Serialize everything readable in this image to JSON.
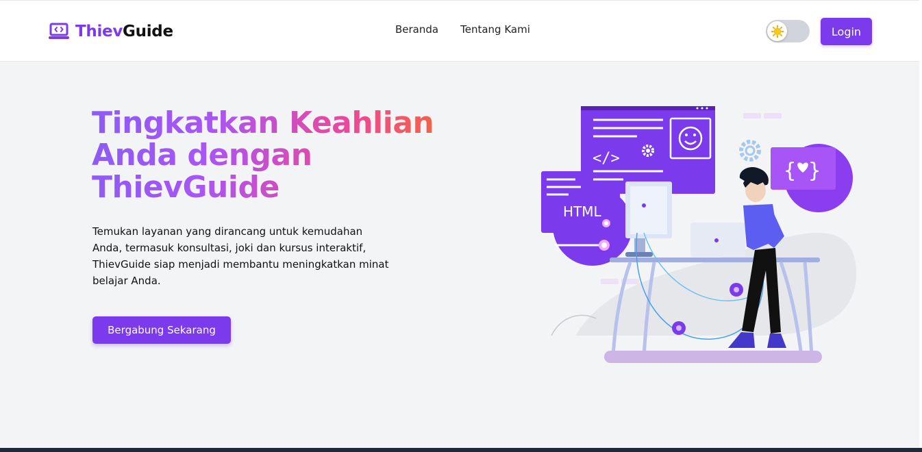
{
  "brand": {
    "part1": "Thiev",
    "part2": "Guide",
    "icon": "laptop-code-icon"
  },
  "nav": {
    "items": [
      {
        "label": "Beranda"
      },
      {
        "label": "Tentang Kami"
      }
    ]
  },
  "theme_toggle": {
    "state": "light",
    "icon": "sun-icon"
  },
  "login": {
    "label": "Login"
  },
  "hero": {
    "title": "Tingkatkan Keahlian Anda dengan ThievGuide",
    "description": "Temukan layanan yang dirancang untuk kemudahan Anda, termasuk konsultasi, joki dan kursus interaktif, ThievGuide siap menjadi membantu meningkatkan minat belajar Anda.",
    "cta": "Bergabung Sekarang"
  },
  "illustration": {
    "html_label": "HTML",
    "code_label": "</>",
    "braces_label": "{ }"
  },
  "colors": {
    "accent": "#7c3aed",
    "background": "#f3f4f6"
  }
}
